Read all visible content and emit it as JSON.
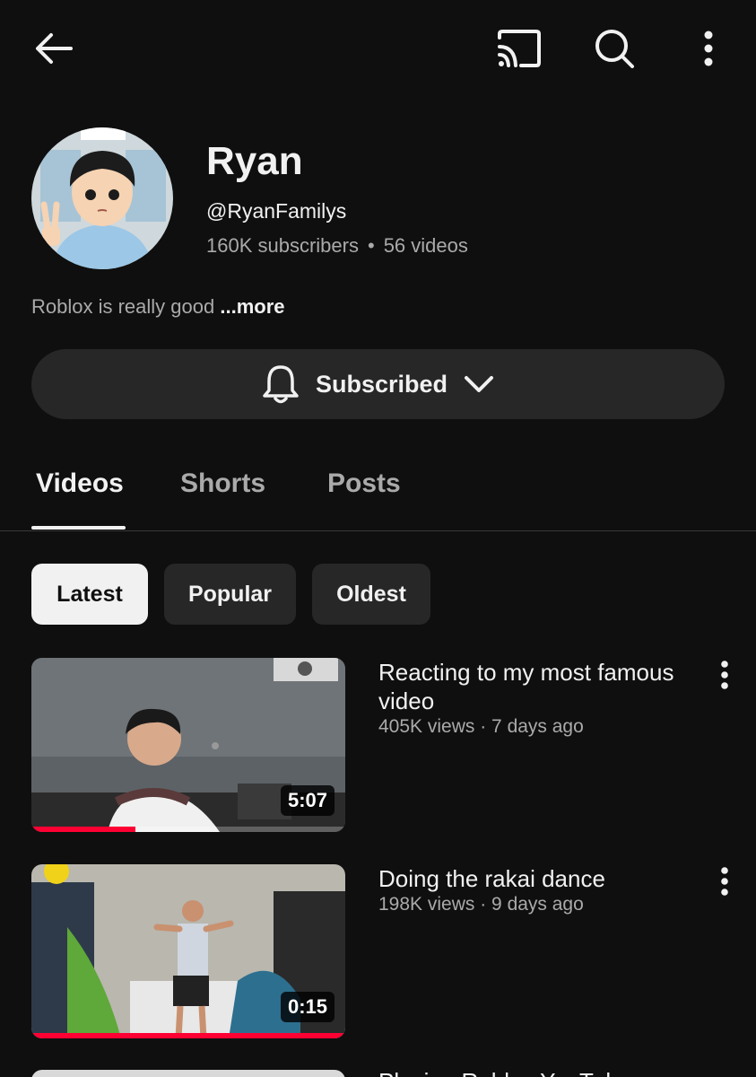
{
  "topbar": {
    "back_icon": "arrow-left-icon",
    "cast_icon": "cast-icon",
    "search_icon": "search-icon",
    "more_icon": "more-vertical-icon"
  },
  "channel": {
    "name": "Ryan",
    "handle": "@RyanFamilys",
    "subscribers": "160K subscribers",
    "separator": "•",
    "video_count": "56 videos",
    "description": "Roblox is really good",
    "description_more": "...more"
  },
  "subscribe_button": {
    "label": "Subscribed",
    "bell_icon": "bell-icon",
    "chevron_icon": "chevron-down-icon"
  },
  "tabs": [
    {
      "label": "Videos",
      "active": true
    },
    {
      "label": "Shorts",
      "active": false
    },
    {
      "label": "Posts",
      "active": false
    }
  ],
  "chips": [
    {
      "label": "Latest",
      "selected": true
    },
    {
      "label": "Popular",
      "selected": false
    },
    {
      "label": "Oldest",
      "selected": false
    }
  ],
  "videos": [
    {
      "title": "Reacting to my most famous video",
      "meta": "405K views · 7 days ago",
      "duration": "5:07",
      "watched_fraction": 0.33
    },
    {
      "title": "Doing the rakai dance",
      "meta": "198K views · 9 days ago",
      "duration": "0:15",
      "watched_fraction": 1.0
    },
    {
      "title": "Playing Roblox YouTube",
      "meta": "",
      "duration": "",
      "watched_fraction": 0
    }
  ],
  "colors": {
    "background": "#0f0f0f",
    "surface": "#272727",
    "text_primary": "#f1f1f1",
    "text_secondary": "#aaaaaa",
    "progress": "#ff0033"
  }
}
